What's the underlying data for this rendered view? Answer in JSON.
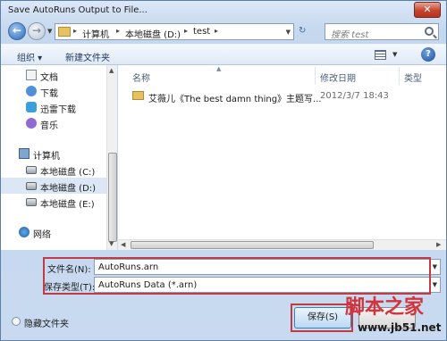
{
  "window": {
    "title": "Save AutoRuns Output to File..."
  },
  "address_bar": {
    "crumbs": [
      "计算机",
      "本地磁盘 (D:)",
      "test"
    ],
    "search_placeholder": "搜索 test"
  },
  "toolbar": {
    "organize": "组织 ▾",
    "new_folder": "新建文件夹"
  },
  "sidebar": {
    "items": [
      {
        "label": "文档",
        "icon": "document-icon"
      },
      {
        "label": "下载",
        "icon": "download-icon"
      },
      {
        "label": "迅雷下载",
        "icon": "xunlei-icon"
      },
      {
        "label": "音乐",
        "icon": "music-icon"
      },
      {
        "label": "计算机",
        "icon": "computer-icon"
      },
      {
        "label": "本地磁盘 (C:)",
        "icon": "drive-icon"
      },
      {
        "label": "本地磁盘 (D:)",
        "icon": "drive-icon",
        "selected": true
      },
      {
        "label": "本地磁盘 (E:)",
        "icon": "drive-icon"
      },
      {
        "label": "网络",
        "icon": "network-icon"
      }
    ]
  },
  "files": {
    "columns": [
      "名称",
      "修改日期",
      "类型"
    ],
    "rows": [
      {
        "name": "艾薇儿《The best damn thing》主题写...",
        "date": "2012/3/7 18:43"
      }
    ]
  },
  "form": {
    "filename_label": "文件名(N):",
    "filename_value": "AutoRuns.arn",
    "filetype_label": "保存类型(T):",
    "filetype_value": "AutoRuns Data (*.arn)"
  },
  "footer": {
    "hide_folders": "隐藏文件夹",
    "save_button": "保存(S)"
  },
  "watermark": {
    "text": "脚本之家",
    "url": "www.jb51.net"
  },
  "colors": {
    "highlight": "#c23a44",
    "accent": "#3c7fb1"
  }
}
